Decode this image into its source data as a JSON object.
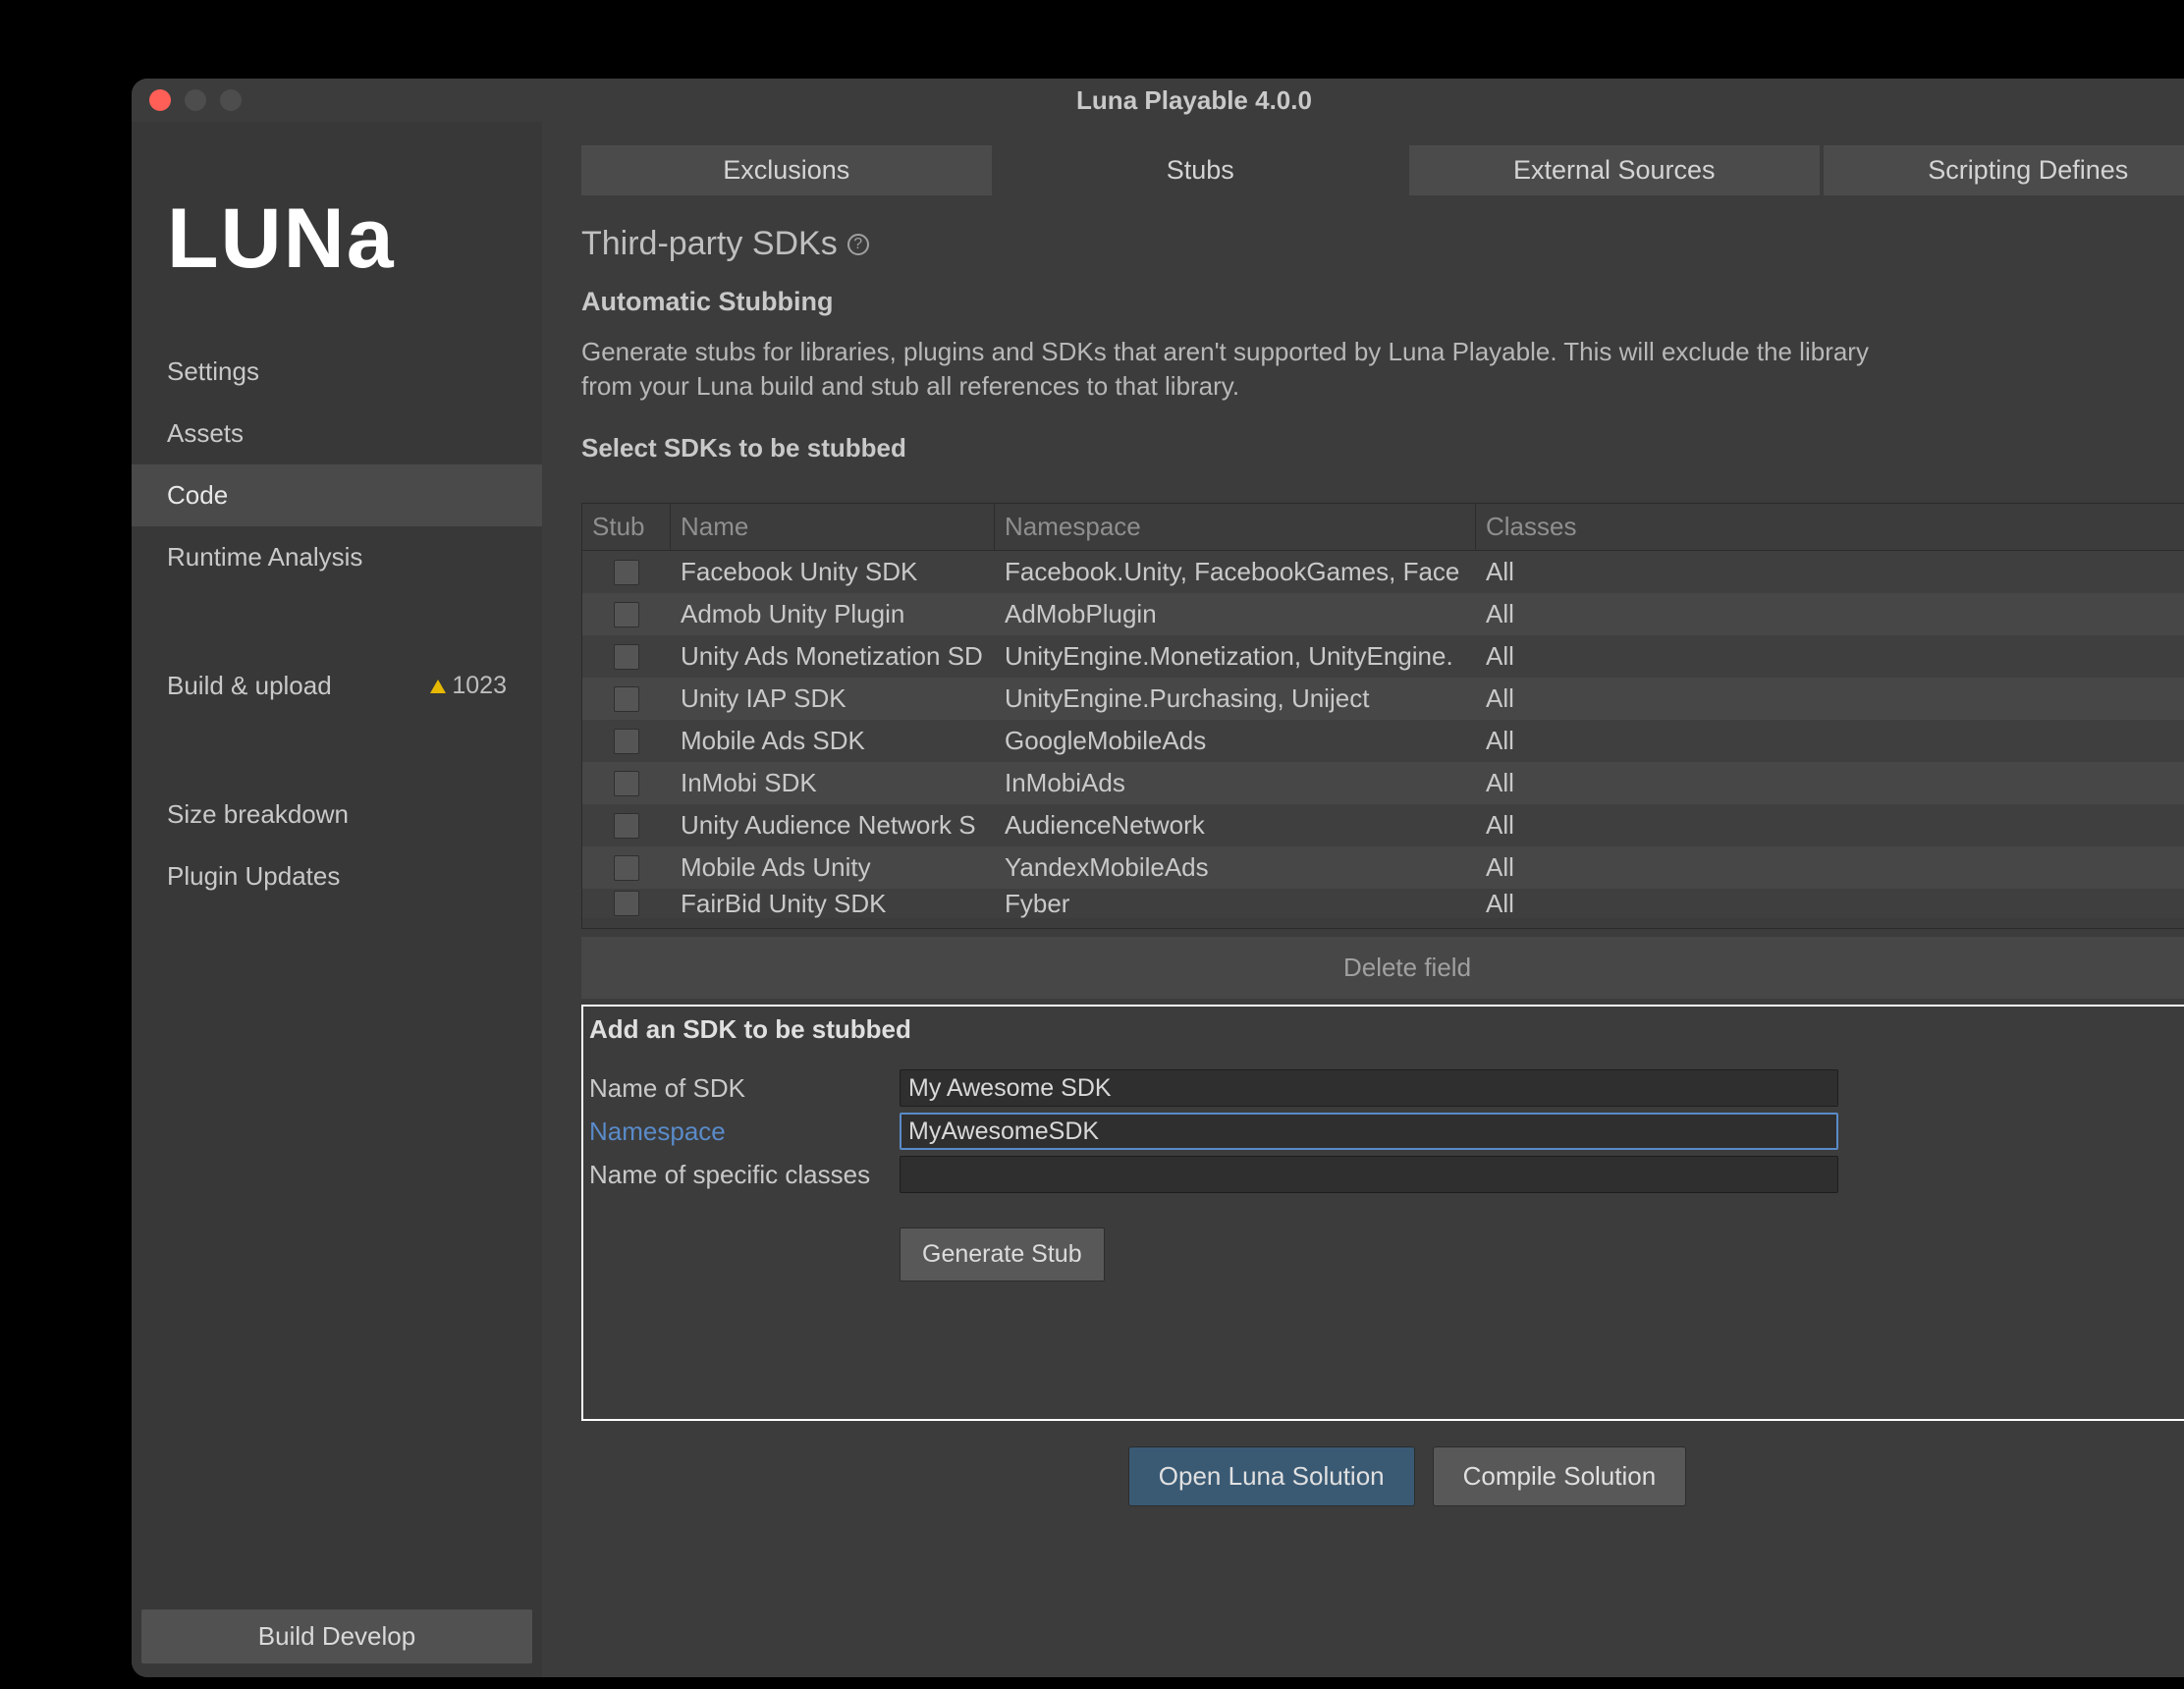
{
  "window_title": "Luna Playable 4.0.0",
  "logo_text": "LUNa",
  "sidebar": {
    "items": [
      {
        "label": "Settings"
      },
      {
        "label": "Assets"
      },
      {
        "label": "Code"
      },
      {
        "label": "Runtime Analysis"
      }
    ],
    "build_upload_label": "Build & upload",
    "build_upload_badge": "1023",
    "size_breakdown_label": "Size breakdown",
    "plugin_updates_label": "Plugin Updates",
    "build_develop_button": "Build Develop"
  },
  "tabs": [
    {
      "label": "Exclusions"
    },
    {
      "label": "Stubs"
    },
    {
      "label": "External Sources"
    },
    {
      "label": "Scripting Defines"
    }
  ],
  "section": {
    "title": "Third-party SDKs",
    "sub_heading": "Automatic Stubbing",
    "description": "Generate stubs for libraries, plugins and SDKs that aren't supported by Luna Playable. This will exclude the library from your Luna build and stub all references to that library.",
    "select_label": "Select SDKs to be stubbed"
  },
  "table": {
    "headers": {
      "stub": "Stub",
      "name": "Name",
      "namespace": "Namespace",
      "classes": "Classes"
    },
    "rows": [
      {
        "name": "Facebook Unity SDK",
        "namespace": "Facebook.Unity, FacebookGames, Face",
        "classes": "All"
      },
      {
        "name": "Admob Unity Plugin",
        "namespace": "AdMobPlugin",
        "classes": "All"
      },
      {
        "name": "Unity Ads Monetization SD",
        "namespace": "UnityEngine.Monetization, UnityEngine.",
        "classes": "All"
      },
      {
        "name": "Unity IAP SDK",
        "namespace": "UnityEngine.Purchasing, Uniject",
        "classes": "All"
      },
      {
        "name": "Mobile Ads SDK",
        "namespace": "GoogleMobileAds",
        "classes": "All"
      },
      {
        "name": "InMobi SDK",
        "namespace": "InMobiAds",
        "classes": "All"
      },
      {
        "name": "Unity Audience Network S",
        "namespace": "AudienceNetwork",
        "classes": "All"
      },
      {
        "name": "Mobile Ads Unity",
        "namespace": "YandexMobileAds",
        "classes": "All"
      },
      {
        "name": "FairBid Unity SDK",
        "namespace": "Fyber",
        "classes": "All"
      }
    ],
    "delete_button": "Delete field"
  },
  "add_form": {
    "title": "Add an SDK to be stubbed",
    "name_label": "Name of SDK",
    "name_value": "My Awesome SDK",
    "namespace_label": "Namespace",
    "namespace_value": "MyAwesomeSDK",
    "classes_label": "Name of specific classes",
    "classes_value": "",
    "generate_button": "Generate Stub"
  },
  "footer": {
    "open_solution": "Open Luna Solution",
    "compile_solution": "Compile Solution"
  }
}
